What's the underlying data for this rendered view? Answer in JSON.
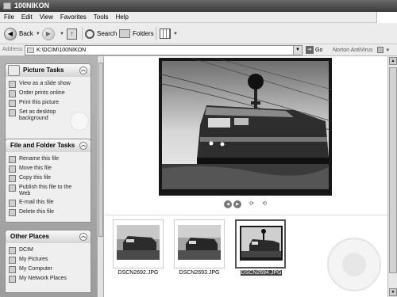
{
  "window": {
    "title": "100NIKON"
  },
  "menu": [
    "File",
    "Edit",
    "View",
    "Favorites",
    "Tools",
    "Help"
  ],
  "toolbar": {
    "back": "Back",
    "search": "Search",
    "folders": "Folders"
  },
  "address": {
    "label": "Address",
    "value": "K:\\DCIM\\100NIKON",
    "go": "Go",
    "antivirus": "Norton AntiVirus"
  },
  "picture_tasks": {
    "title": "Picture Tasks",
    "items": [
      "View as a slide show",
      "Order prints online",
      "Print this picture",
      "Set as desktop background"
    ]
  },
  "file_folder_tasks": {
    "title": "File and Folder Tasks",
    "items": [
      "Rename this file",
      "Move this file",
      "Copy this file",
      "Publish this file to the Web",
      "E-mail this file",
      "Delete this file"
    ]
  },
  "other_places": {
    "title": "Other Places",
    "items": [
      "DCIM",
      "My Pictures",
      "My Computer",
      "My Network Places"
    ]
  },
  "thumbnails": [
    {
      "name": "DSCN2692.JPG",
      "selected": false
    },
    {
      "name": "DSCN2693.JPG",
      "selected": false
    },
    {
      "name": "DSCN2694.JPG",
      "selected": true
    }
  ],
  "icons": {
    "back": "back-arrow-icon",
    "forward": "forward-arrow-icon",
    "up": "folder-up-icon",
    "search": "magnifier-icon",
    "folders": "folders-icon",
    "views": "views-icon"
  }
}
